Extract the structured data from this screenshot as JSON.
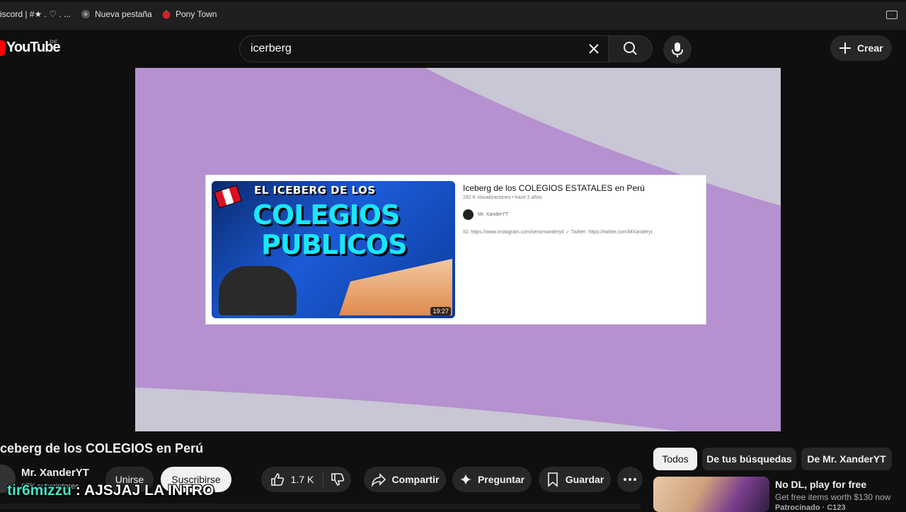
{
  "bookmarks": [
    {
      "label": "iscord | #★ . ♡ . ..."
    },
    {
      "label": "Nueva pestaña"
    },
    {
      "label": "Pony Town"
    }
  ],
  "masthead": {
    "logo_text": "YouTube",
    "country_code": "PE",
    "search_query": "icerberg",
    "create_label": "Crear"
  },
  "card": {
    "title": "Iceberg de los COLEGIOS ESTATALES en Perú",
    "meta": "282 K visualizaciones • hace 2 años",
    "channel": "Mr. XanderYT",
    "description": "IG: https://www.instagram.com/senorxanderyt/ ✓ Twitter: https://twitter.com/MXanderyt",
    "duration": "19:27",
    "thumb_line1": "EL ICEBERG DE LOS",
    "thumb_line2": "COLEGIOS",
    "thumb_line3": "PUBLICOS"
  },
  "video": {
    "title": "ceberg de los COLEGIOS en Perú",
    "channel_name": "Mr. XanderYT",
    "subscribers": "97K suscriptores",
    "join_label": "Unirse",
    "subscribe_label": "Suscribirse",
    "likes": "1.7 K",
    "share_label": "Compartir",
    "ask_label": "Preguntar",
    "save_label": "Guardar"
  },
  "overlay": {
    "user": "tir6mizzu",
    "message": ": AJSJAJ LA INTRO"
  },
  "chips": [
    {
      "label": "Todos"
    },
    {
      "label": "De tus búsquedas"
    },
    {
      "label": "De Mr. XanderYT"
    }
  ],
  "sponsored": {
    "title": "No DL, play for free",
    "subtitle": "Get free items worth $130 now",
    "tag": "Patrocinado · C123"
  },
  "colors": {
    "player_purple": "#b591cf",
    "player_gray": "#c9c6d5",
    "overlay_user": "#43e6c6",
    "brand_red": "#ff0000"
  }
}
